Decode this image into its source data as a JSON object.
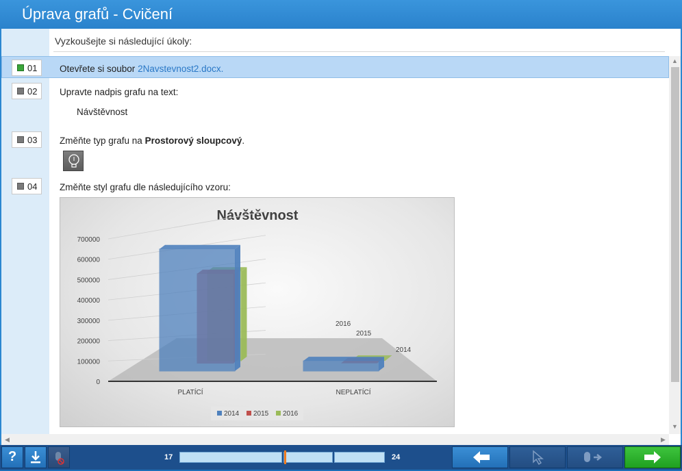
{
  "window": {
    "title": "Úprava grafů - Cvičení"
  },
  "intro": "Vyzkoušejte si následující úkoly:",
  "tasks": [
    {
      "num": "01",
      "text_prefix": "Otevřete si soubor ",
      "link": "2Navstevnost2.docx.",
      "done": true
    },
    {
      "num": "02",
      "text": "Upravte nadpis grafu na text:",
      "sub": "Návštěvnost",
      "done": false
    },
    {
      "num": "03",
      "text_prefix": "Změňte typ grafu na ",
      "bold": "Prostorový sloupcový",
      "text_suffix": ".",
      "done": false
    },
    {
      "num": "04",
      "text": "Změňte styl grafu dle následujícího vzoru:",
      "done": false
    }
  ],
  "hint_icon": "lightbulb-icon",
  "chart_data": {
    "type": "bar",
    "title": "Návštěvnost",
    "categories": [
      "PLATÍCÍ",
      "NEPLATÍCÍ"
    ],
    "series": [
      {
        "name": "2014",
        "values": [
          600000,
          50000
        ]
      },
      {
        "name": "2015",
        "values": [
          440000,
          20000
        ]
      },
      {
        "name": "2016",
        "values": [
          440000,
          20000
        ]
      }
    ],
    "ylim": [
      0,
      700000
    ],
    "yticks": [
      "700000",
      "600000",
      "500000",
      "400000",
      "300000",
      "200000",
      "100000",
      "0"
    ],
    "depth_labels": [
      "2016",
      "2015",
      "2014"
    ],
    "legend": [
      "2014",
      "2015",
      "2016"
    ],
    "legend_placement": "bottom",
    "colors": {
      "2014": "#4f81bd",
      "2015": "#c0504d",
      "2016": "#9bbb59"
    }
  },
  "progress": {
    "current": "17",
    "total": "24"
  },
  "toolbar": {
    "help_label": "?",
    "download_icon": "download-icon",
    "mute_icon": "mouse-disabled-icon",
    "back_icon": "arrow-left-icon",
    "cursor_icon": "cursor-icon",
    "mouse_next_icon": "mouse-next-icon",
    "next_icon": "arrow-right-icon"
  },
  "colors": {
    "accent": "#2b87d1",
    "bar": "#1d4f8c",
    "highlight": "#b9d8f6"
  }
}
